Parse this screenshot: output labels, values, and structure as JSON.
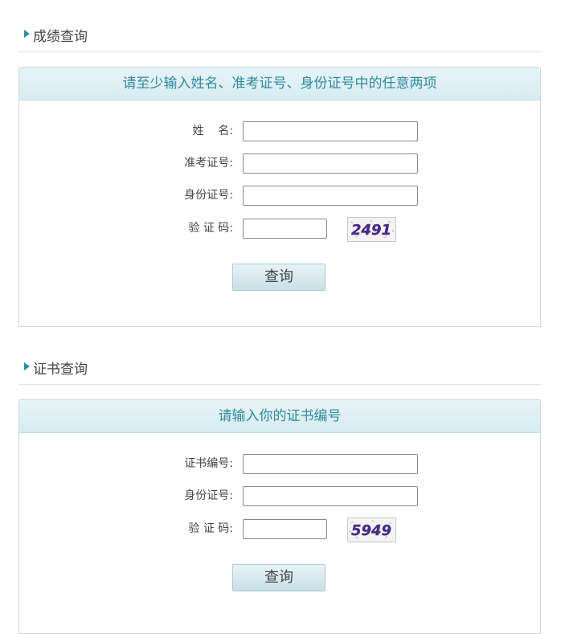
{
  "score_section": {
    "title": "成绩查询",
    "panel_title": "请至少输入姓名、准考证号、身份证号中的任意两项",
    "fields": {
      "name_label": "姓    名:",
      "exam_no_label": "准考证号:",
      "id_no_label": "身份证号:",
      "captcha_label": "验 证 码:"
    },
    "captcha_text": "2491",
    "button_label": "查询"
  },
  "cert_section": {
    "title": "证书查询",
    "panel_title": "请输入你的证书编号",
    "fields": {
      "cert_no_label": "证书编号:",
      "id_no_label": "身份证号:",
      "captcha_label": "验 证 码:"
    },
    "captcha_text": "5949",
    "button_label": "查询"
  },
  "colors": {
    "accent": "#2f8aa0",
    "panel_header_bg": "#dcedf2",
    "captcha_text": "#3b2f8f"
  }
}
